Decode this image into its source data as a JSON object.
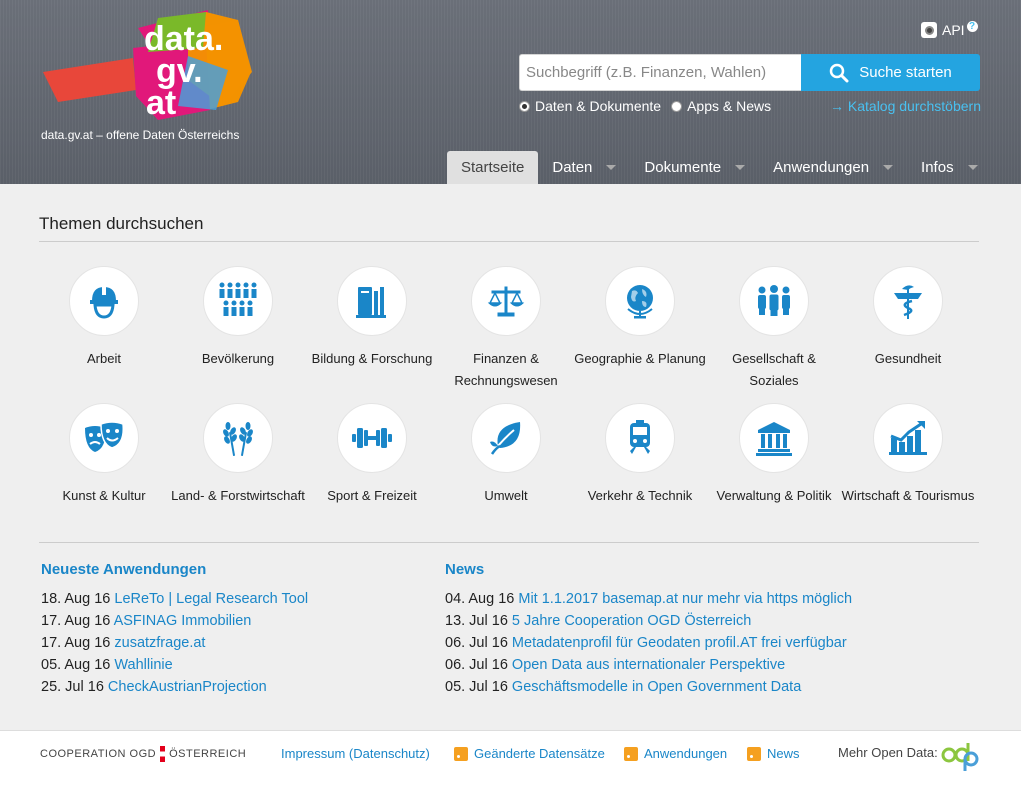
{
  "header": {
    "logo_text": [
      "data.",
      "gv.",
      "at"
    ],
    "tagline": "data.gv.at – offene Daten Österreichs",
    "api_label": "API",
    "api_help": "?",
    "search_placeholder": "Suchbegriff (z.B. Finanzen, Wahlen)",
    "search_button": "Suche starten",
    "radio_data": "Daten & Dokumente",
    "radio_apps": "Apps & News",
    "catalog_link": "→ Katalog durchstöbern",
    "nav": [
      "Startseite",
      "Daten",
      "Dokumente",
      "Anwendungen",
      "Infos"
    ]
  },
  "topics_title": "Themen durchsuchen",
  "topics": [
    {
      "label": "Arbeit",
      "icon": "worker-helmet-icon"
    },
    {
      "label": "Bevölkerung",
      "icon": "population-icon"
    },
    {
      "label": "Bildung & Forschung",
      "icon": "books-icon"
    },
    {
      "label": "Finanzen & Rechnungswesen",
      "icon": "scales-icon"
    },
    {
      "label": "Geographie & Planung",
      "icon": "globe-icon"
    },
    {
      "label": "Gesellschaft & Soziales",
      "icon": "people-group-icon"
    },
    {
      "label": "Gesundheit",
      "icon": "caduceus-icon"
    },
    {
      "label": "Kunst & Kultur",
      "icon": "theater-masks-icon"
    },
    {
      "label": "Land- & Forstwirtschaft",
      "icon": "wheat-icon"
    },
    {
      "label": "Sport & Freizeit",
      "icon": "dumbbell-icon"
    },
    {
      "label": "Umwelt",
      "icon": "leaf-icon"
    },
    {
      "label": "Verkehr & Technik",
      "icon": "train-icon"
    },
    {
      "label": "Verwaltung & Politik",
      "icon": "government-building-icon"
    },
    {
      "label": "Wirtschaft & Tourismus",
      "icon": "chart-growth-icon"
    }
  ],
  "apps_title": "Neueste Anwendungen",
  "apps": [
    {
      "date": "18. Aug 16",
      "title": "LeReTo | Legal Research Tool"
    },
    {
      "date": "17. Aug 16",
      "title": "ASFINAG Immobilien"
    },
    {
      "date": "17. Aug 16",
      "title": "zusatzfrage.at"
    },
    {
      "date": "05. Aug 16",
      "title": "Wahllinie"
    },
    {
      "date": "25. Jul 16",
      "title": "CheckAustrianProjection"
    }
  ],
  "news_title": "News",
  "news": [
    {
      "date": "04. Aug 16",
      "title": "Mit 1.1.2017 basemap.at nur mehr via https möglich"
    },
    {
      "date": "13. Jul 16",
      "title": "5 Jahre Cooperation OGD Österreich"
    },
    {
      "date": "06. Jul 16",
      "title": "Metadatenprofil für Geodaten profil.AT frei verfügbar"
    },
    {
      "date": "06. Jul 16",
      "title": "Open Data aus internationaler Perspektive"
    },
    {
      "date": "05. Jul 16",
      "title": "Geschäftsmodelle in Open Government Data"
    }
  ],
  "footer": {
    "coop_left": "COOPERATION OGD",
    "coop_right": "ÖSTERREICH",
    "impressum": "Impressum",
    "datenschutz": "(Datenschutz)",
    "feed_datasets": "Geänderte Datensätze",
    "feed_apps": "Anwendungen",
    "feed_news": "News",
    "more_open_data": "Mehr Open Data:"
  },
  "colors": {
    "accent": "#24a4e0",
    "link": "#1a86c8",
    "icon": "#1a86c8",
    "header_bg": "#626770"
  }
}
